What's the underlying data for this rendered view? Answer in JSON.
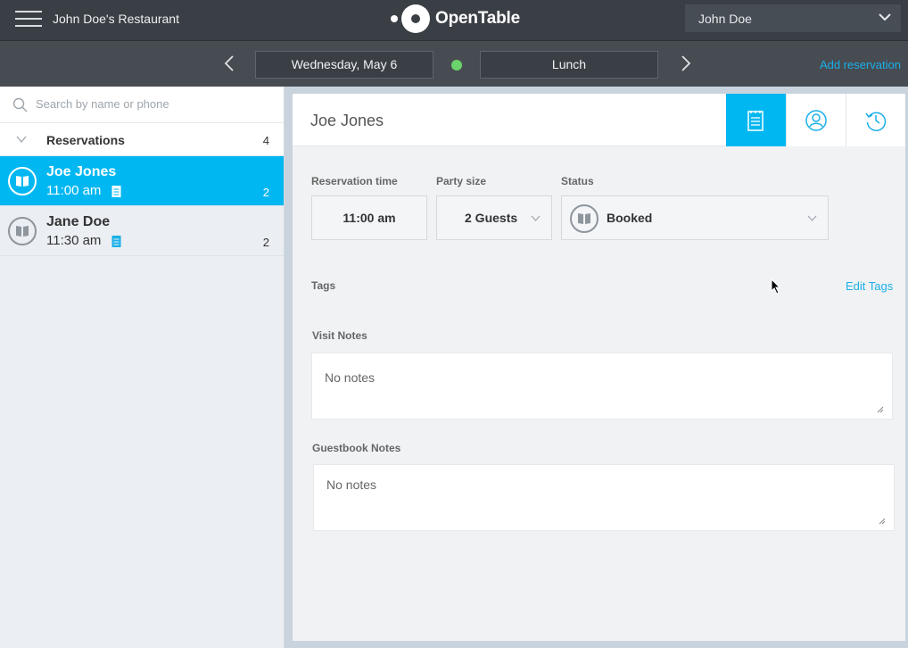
{
  "topbar": {
    "restaurant_name": "John Doe's Restaurant",
    "logo_text": "OpenTable",
    "user_name": "John Doe"
  },
  "navbar": {
    "date": "Wednesday, May 6",
    "shift": "Lunch",
    "add_reservation": "Add reservation",
    "status_color": "#6bd36b"
  },
  "sidebar": {
    "search_placeholder": "Search by name or phone",
    "section_title": "Reservations",
    "section_count": "4",
    "items": [
      {
        "name": "Joe Jones",
        "time": "11:00 am",
        "party": "2",
        "selected": true
      },
      {
        "name": "Jane Doe",
        "time": "11:30 am",
        "party": "2",
        "selected": false
      }
    ]
  },
  "main": {
    "guest_name": "Joe Jones",
    "tabs": [
      "reservation-tab",
      "guest-profile-tab",
      "history-tab"
    ],
    "reservation_time_label": "Reservation time",
    "reservation_time": "11:00 am",
    "party_size_label": "Party size",
    "party_size": "2 Guests",
    "status_label": "Status",
    "status": "Booked",
    "tags_label": "Tags",
    "edit_tags": "Edit Tags",
    "visit_notes_label": "Visit Notes",
    "visit_notes_placeholder": "No notes",
    "guestbook_notes_label": "Guestbook Notes",
    "guestbook_notes_placeholder": "No notes"
  },
  "colors": {
    "accent": "#00b7f1",
    "topbar": "#3a3f45",
    "link": "#1ab0e8"
  }
}
